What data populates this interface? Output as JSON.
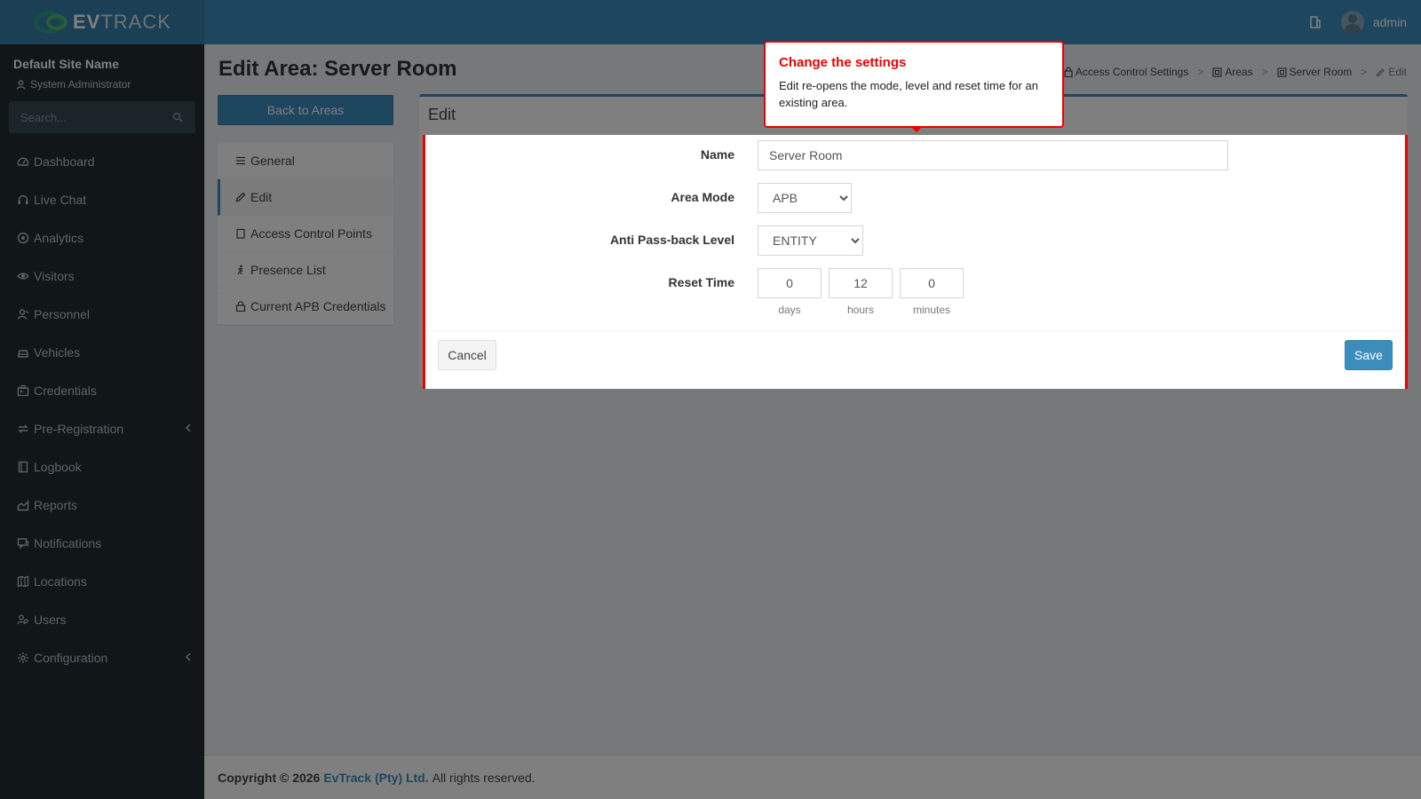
{
  "header": {
    "logo_text_bold": "EV",
    "logo_text": "TRACK",
    "user_name": "admin"
  },
  "sidebar": {
    "site_name": "Default Site Name",
    "role": "System Administrator",
    "search_placeholder": "Search...",
    "items": [
      {
        "label": "Dashboard",
        "icon": "dashboard-icon"
      },
      {
        "label": "Live Chat",
        "icon": "headset-icon"
      },
      {
        "label": "Analytics",
        "icon": "analytics-icon"
      },
      {
        "label": "Visitors",
        "icon": "eye-icon"
      },
      {
        "label": "Personnel",
        "icon": "person-icon"
      },
      {
        "label": "Vehicles",
        "icon": "car-icon"
      },
      {
        "label": "Credentials",
        "icon": "badge-icon"
      },
      {
        "label": "Pre-Registration",
        "icon": "swap-icon",
        "has_children": true
      },
      {
        "label": "Logbook",
        "icon": "book-icon"
      },
      {
        "label": "Reports",
        "icon": "chart-icon"
      },
      {
        "label": "Notifications",
        "icon": "chat-icon"
      },
      {
        "label": "Locations",
        "icon": "map-icon"
      },
      {
        "label": "Users",
        "icon": "users-icon"
      },
      {
        "label": "Configuration",
        "icon": "gear-icon",
        "has_children": true
      }
    ]
  },
  "page": {
    "title": "Edit Area: Server Room",
    "breadcrumb": [
      "Access Control Settings",
      "Areas",
      "Server Room",
      "Edit"
    ],
    "back_button": "Back to Areas",
    "subnav": [
      {
        "label": "General",
        "icon": "list-icon"
      },
      {
        "label": "Edit",
        "icon": "pencil-icon",
        "active": true
      },
      {
        "label": "Access Control Points",
        "icon": "square-icon"
      },
      {
        "label": "Presence List",
        "icon": "walking-icon"
      },
      {
        "label": "Current APB Credentials",
        "icon": "lock-icon"
      }
    ],
    "box_title": "Edit"
  },
  "form": {
    "name_label": "Name",
    "name_value": "Server Room",
    "area_mode_label": "Area Mode",
    "area_mode_value": "APB",
    "apb_level_label": "Anti Pass-back Level",
    "apb_level_value": "ENTITY",
    "reset_time_label": "Reset Time",
    "reset_days": "0",
    "reset_hours": "12",
    "reset_minutes": "0",
    "days_label": "days",
    "hours_label": "hours",
    "minutes_label": "minutes",
    "cancel_label": "Cancel",
    "save_label": "Save"
  },
  "tooltip": {
    "title": "Change the settings",
    "body": "Edit re-opens the mode, level and reset time for an existing area."
  },
  "footer": {
    "copyright": "Copyright © 2026",
    "company": "EvTrack (Pty) Ltd.",
    "rights": "All rights reserved."
  },
  "colors": {
    "primary": "#3c8dbc",
    "sidebar_bg": "#222d32",
    "highlight": "#ee0000"
  }
}
